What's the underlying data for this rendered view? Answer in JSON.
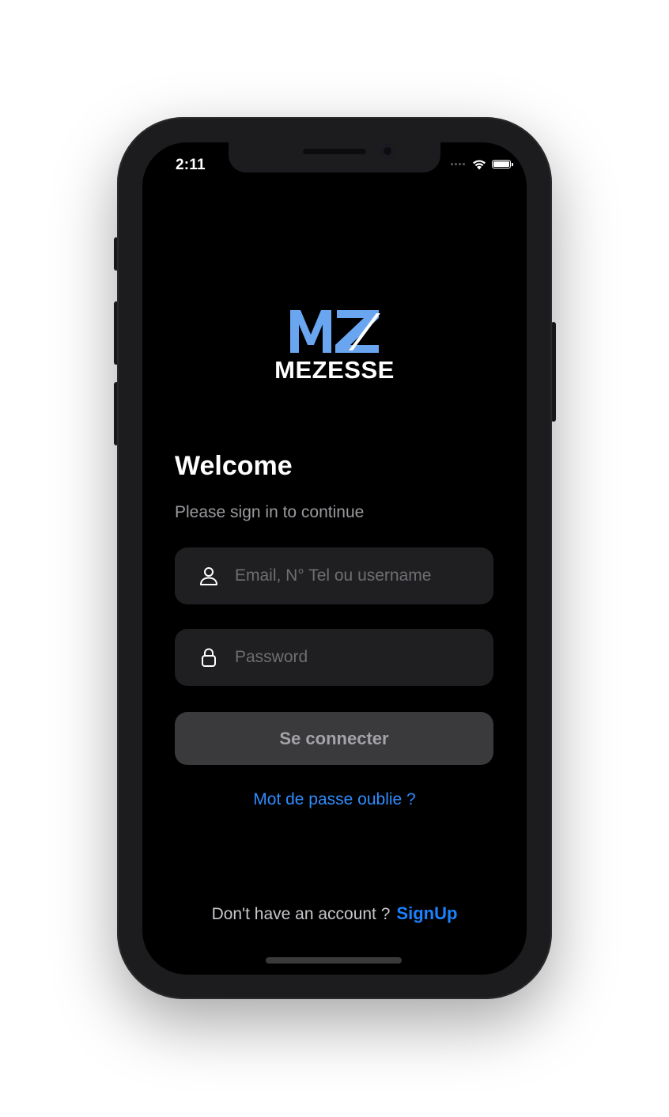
{
  "status_bar": {
    "time": "2:11",
    "icons": [
      "signal-dots-icon",
      "wifi-icon",
      "battery-icon"
    ]
  },
  "brand": {
    "mark": "MZ",
    "wordmark": "MEZESSE",
    "colors": {
      "mark_blue": "#6aa6f0",
      "wordmark": "#ffffff"
    }
  },
  "login": {
    "title": "Welcome",
    "subtitle": "Please sign in to continue",
    "identifier_field": {
      "placeholder": "Email, N° Tel ou username",
      "value": "",
      "icon": "user-icon"
    },
    "password_field": {
      "placeholder": "Password",
      "value": "",
      "icon": "lock-icon"
    },
    "submit_label": "Se connecter",
    "forgot_label": "Mot de passe oublie ?",
    "signup_prompt": "Don't have an account ?",
    "signup_label": "SignUp"
  },
  "colors": {
    "background": "#000000",
    "field_bg": "#1f1f21",
    "button_bg": "#3a3a3c",
    "link": "#2f8cff"
  }
}
